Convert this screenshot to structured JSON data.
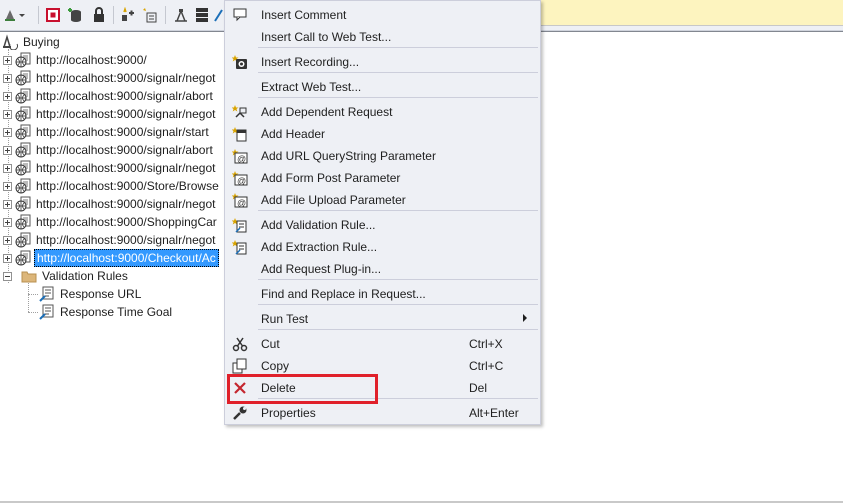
{
  "tree": {
    "root": {
      "label": "Buying",
      "icon": "web-test-icon"
    },
    "requests": [
      {
        "label": "http://localhost:9000/"
      },
      {
        "label": "http://localhost:9000/signalr/negot"
      },
      {
        "label": "http://localhost:9000/signalr/abort"
      },
      {
        "label": "http://localhost:9000/signalr/negot"
      },
      {
        "label": "http://localhost:9000/signalr/start"
      },
      {
        "label": "http://localhost:9000/signalr/abort"
      },
      {
        "label": "http://localhost:9000/signalr/negot"
      },
      {
        "label": "http://localhost:9000/Store/Browse"
      },
      {
        "label": "http://localhost:9000/signalr/negot"
      },
      {
        "label": "http://localhost:9000/ShoppingCar"
      },
      {
        "label": "http://localhost:9000/signalr/negot"
      },
      {
        "label": "http://localhost:9000/Checkout/Ac",
        "selected": true
      }
    ],
    "validation_rules": {
      "label": "Validation Rules",
      "children": [
        {
          "label": "Response URL"
        },
        {
          "label": "Response Time Goal"
        }
      ]
    }
  },
  "context_menu": {
    "items": [
      {
        "label": "Insert Comment",
        "icon": "comment-icon"
      },
      {
        "label": "Insert Call to Web Test..."
      },
      {
        "label": "Insert Recording...",
        "icon": "recording-icon"
      },
      {
        "label": "Extract Web Test..."
      },
      {
        "label": "Add Dependent Request",
        "icon": "dependent-request-icon"
      },
      {
        "label": "Add Header",
        "icon": "header-icon"
      },
      {
        "label": "Add URL QueryString Parameter",
        "icon": "querystring-parameter-icon"
      },
      {
        "label": "Add Form Post Parameter",
        "icon": "form-post-parameter-icon"
      },
      {
        "label": "Add File Upload Parameter",
        "icon": "file-upload-parameter-icon"
      },
      {
        "label": "Add Validation Rule...",
        "icon": "validation-rule-icon"
      },
      {
        "label": "Add Extraction Rule...",
        "icon": "extraction-rule-icon"
      },
      {
        "label": "Add Request Plug-in..."
      },
      {
        "label": "Find and Replace in Request..."
      },
      {
        "label": "Run Test"
      },
      {
        "label": "Cut",
        "shortcut": "Ctrl+X",
        "icon": "scissors-icon"
      },
      {
        "label": "Copy",
        "shortcut": "Ctrl+C",
        "icon": "copy-icon"
      },
      {
        "label": "Delete",
        "shortcut": "Del",
        "icon": "delete-x-icon"
      },
      {
        "label": "Properties",
        "shortcut": "Alt+Enter",
        "icon": "wrench-icon"
      }
    ]
  },
  "colors": {
    "selection": "#3399ff",
    "menu_bg": "#eef0f5",
    "highlight_box": "#e0202a",
    "delete_icon": "#c4262e"
  }
}
